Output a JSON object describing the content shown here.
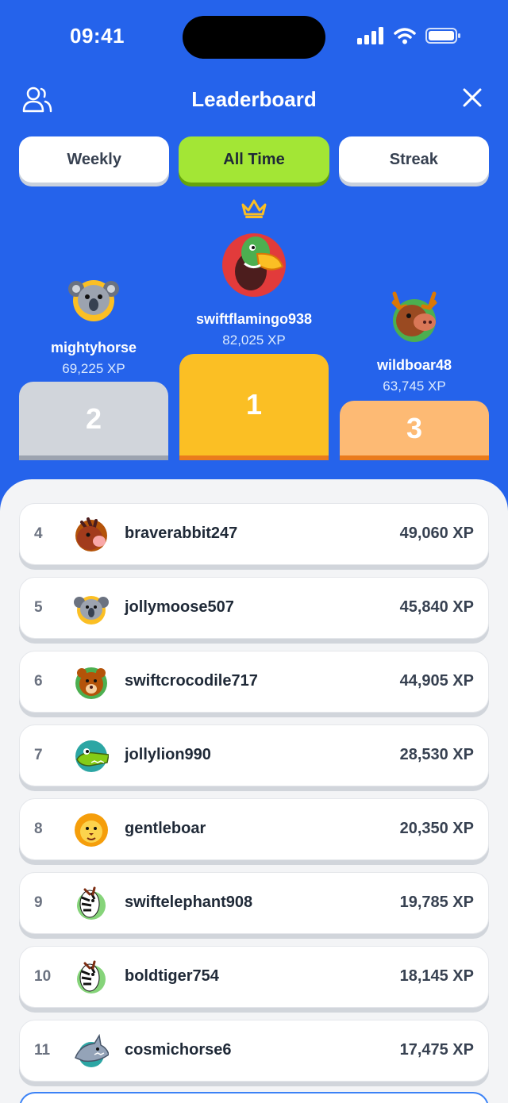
{
  "status_bar": {
    "time": "09:41"
  },
  "header": {
    "title": "Leaderboard"
  },
  "tabs": [
    {
      "label": "Weekly",
      "active": false
    },
    {
      "label": "All Time",
      "active": true
    },
    {
      "label": "Streak",
      "active": false
    }
  ],
  "podium": {
    "first": {
      "rank": "1",
      "name": "swiftflamingo938",
      "xp": "82,025 XP",
      "avatar": "duck-avatar",
      "color": "#FBBF24"
    },
    "second": {
      "rank": "2",
      "name": "mightyhorse",
      "xp": "69,225 XP",
      "avatar": "koala-avatar",
      "color": "#D1D5DB"
    },
    "third": {
      "rank": "3",
      "name": "wildboar48",
      "xp": "63,745 XP",
      "avatar": "moose-avatar",
      "color": "#FDBA74"
    }
  },
  "list": [
    {
      "rank": "4",
      "name": "braverabbit247",
      "xp": "49,060 XP",
      "avatar": "boar-avatar"
    },
    {
      "rank": "5",
      "name": "jollymoose507",
      "xp": "45,840 XP",
      "avatar": "koala-avatar"
    },
    {
      "rank": "6",
      "name": "swiftcrocodile717",
      "xp": "44,905 XP",
      "avatar": "bear-avatar"
    },
    {
      "rank": "7",
      "name": "jollylion990",
      "xp": "28,530 XP",
      "avatar": "crocodile-avatar"
    },
    {
      "rank": "8",
      "name": "gentleboar",
      "xp": "20,350 XP",
      "avatar": "lion-avatar"
    },
    {
      "rank": "9",
      "name": "swiftelephant908",
      "xp": "19,785 XP",
      "avatar": "zebra-avatar"
    },
    {
      "rank": "10",
      "name": "boldtiger754",
      "xp": "18,145 XP",
      "avatar": "zebra-avatar"
    },
    {
      "rank": "11",
      "name": "cosmichorse6",
      "xp": "17,475 XP",
      "avatar": "shark-avatar"
    }
  ],
  "colors": {
    "background": "#2563EB",
    "active_tab": "#A3E635",
    "crown": "#FBBF24"
  }
}
